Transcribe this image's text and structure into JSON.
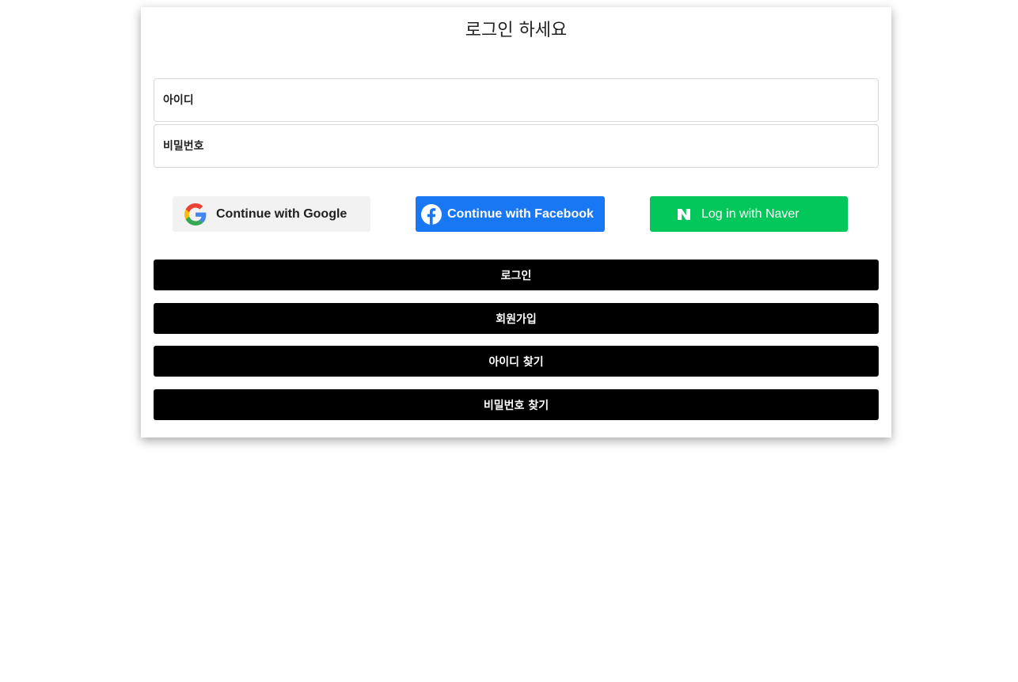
{
  "header": {
    "title": "로그인 하세요"
  },
  "form": {
    "id_placeholder": "아이디",
    "id_value": "",
    "pw_placeholder": "비밀번호",
    "pw_value": ""
  },
  "social": {
    "google_label": "Continue with Google",
    "facebook_label": "Continue with Facebook",
    "naver_label": "Log in with Naver",
    "icons": {
      "google": "google-logo-icon",
      "facebook": "facebook-logo-icon",
      "naver": "naver-logo-icon"
    }
  },
  "buttons": {
    "login": "로그인",
    "signup": "회원가입",
    "find_id": "아이디 찾기",
    "find_pw": "비밀번호 찾기"
  },
  "colors": {
    "google_bg": "#f2f2f2",
    "facebook_bg": "#1877f2",
    "naver_bg": "#03c75a",
    "button_bg": "#000000"
  }
}
